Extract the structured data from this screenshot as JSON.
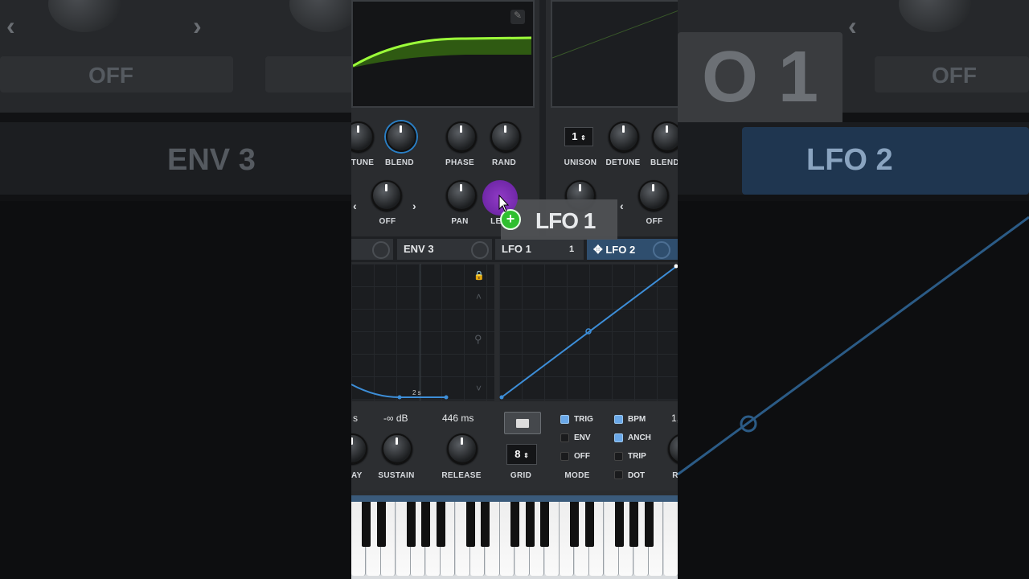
{
  "background": {
    "left": {
      "off_label": "OFF",
      "env_tab": "ENV 3"
    },
    "right": {
      "off_label": "OFF",
      "lfo_tab": "LFO 2",
      "lfo_overlay": "O 1"
    }
  },
  "osc_a": {
    "knobs": [
      {
        "label": "TUNE"
      },
      {
        "label": "BLEND"
      },
      {
        "label": "PHASE"
      },
      {
        "label": "RAND"
      }
    ],
    "row2": [
      {
        "label": "OFF"
      },
      {
        "label": "PAN"
      },
      {
        "label": "LEVEL"
      }
    ]
  },
  "osc_b": {
    "unison_value": "1",
    "knobs": [
      {
        "label": "UNISON"
      },
      {
        "label": "DETUNE"
      },
      {
        "label": "BLEND"
      }
    ],
    "row2": [
      {
        "label": "OFF"
      }
    ]
  },
  "drag_label": "LFO 1",
  "tabs": {
    "env3": "ENV 3",
    "lfo1": "LFO 1",
    "lfo1_count": "1",
    "lfo2": "LFO 2"
  },
  "env": {
    "time_marker": "2 s",
    "readouts": {
      "decay": "s",
      "sustain": "-∞ dB",
      "release": "446 ms"
    },
    "labels": {
      "decay": "AY",
      "sustain": "SUSTAIN",
      "release": "RELEASE"
    }
  },
  "lfo_controls": {
    "grid_value": "8",
    "grid_label": "GRID",
    "mode_label": "MODE",
    "mode_options": [
      {
        "label": "TRIG",
        "checked": true
      },
      {
        "label": "ENV",
        "checked": false
      },
      {
        "label": "OFF",
        "checked": false
      }
    ],
    "rate_options": [
      {
        "label": "BPM",
        "checked": true
      },
      {
        "label": "ANCH",
        "checked": true
      },
      {
        "label": "TRIP",
        "checked": false
      },
      {
        "label": "DOT",
        "checked": false
      }
    ],
    "rate_value_partial": "1,",
    "rate_label_partial": "R"
  },
  "colors": {
    "accent_green": "#9cff3a",
    "accent_blue": "#3d8ed8",
    "drag_purple": "#8a2be2"
  }
}
